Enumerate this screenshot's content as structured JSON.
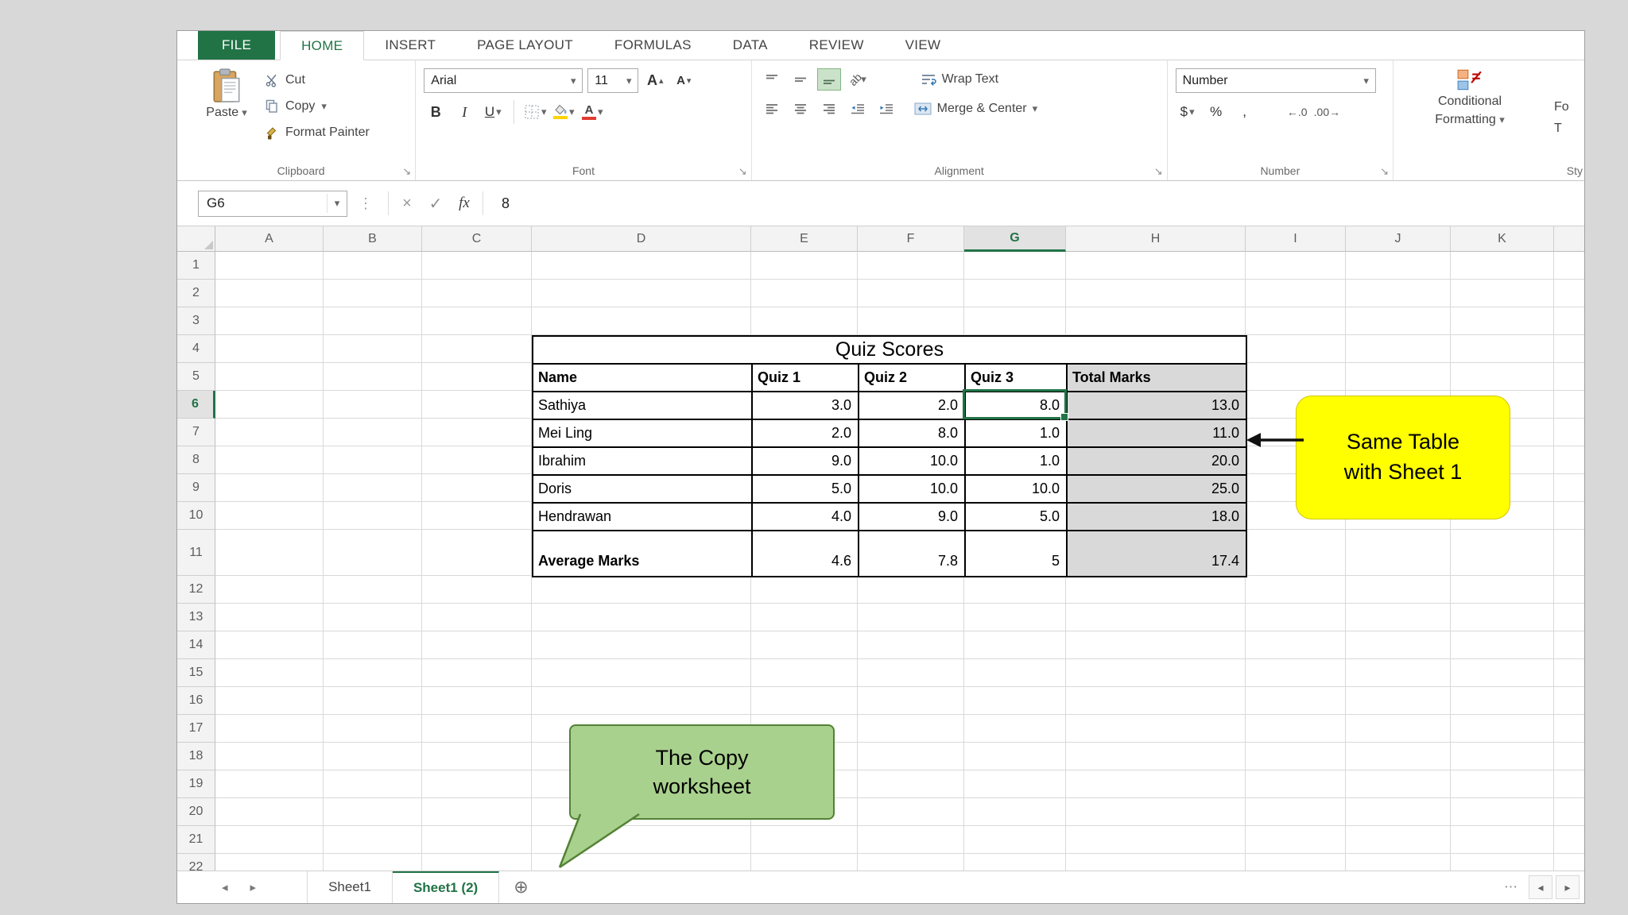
{
  "icons": {
    "chevron_down": "▾",
    "chevron_up": "▴",
    "check": "✓",
    "close": "×",
    "dots_vertical": "⋮",
    "nav_left": "◂",
    "nav_right": "▸",
    "add_sheet": "⊕",
    "ellipsis": "⋯",
    "launcher": "↘"
  },
  "ribbon": {
    "tabs": [
      {
        "label": "FILE"
      },
      {
        "label": "HOME"
      },
      {
        "label": "INSERT"
      },
      {
        "label": "PAGE LAYOUT"
      },
      {
        "label": "FORMULAS"
      },
      {
        "label": "DATA"
      },
      {
        "label": "REVIEW"
      },
      {
        "label": "VIEW"
      }
    ],
    "clipboard": {
      "paste": "Paste",
      "cut": "Cut",
      "copy": "Copy",
      "format_painter": "Format Painter",
      "group": "Clipboard"
    },
    "font": {
      "name_value": "Arial",
      "size_value": "11",
      "bold": "B",
      "italic": "I",
      "underline": "U",
      "letter_a": "A",
      "group": "Font"
    },
    "alignment": {
      "orientation": "ab",
      "wrap_text": "Wrap Text",
      "merge_center": "Merge & Center",
      "group": "Alignment"
    },
    "number": {
      "format_value": "Number",
      "currency": "$",
      "percent": "%",
      "comma": ",",
      "inc_decimal": "←.0",
      "dec_decimal": ".00→",
      "group": "Number"
    },
    "styles": {
      "cf_line1": "Conditional",
      "cf_line2": "Formatting",
      "partial_line1": "Fo",
      "partial_line2": "T",
      "group": "Sty"
    }
  },
  "formula": {
    "name_box": "G6",
    "fx": "fx",
    "value": "8"
  },
  "grid": {
    "columns": [
      "A",
      "B",
      "C",
      "D",
      "E",
      "F",
      "G",
      "H",
      "I",
      "J",
      "K"
    ],
    "row_count": 22,
    "selected_column": "G",
    "selected_row": 6,
    "selected_cell": "G6"
  },
  "table": {
    "title": "Quiz Scores",
    "columns": [
      "Name",
      "Quiz 1",
      "Quiz 2",
      "Quiz 3",
      "Total Marks"
    ],
    "rows": [
      [
        "Sathiya",
        "3.0",
        "2.0",
        "8.0",
        "13.0"
      ],
      [
        "Mei Ling",
        "2.0",
        "8.0",
        "1.0",
        "11.0"
      ],
      [
        "Ibrahim",
        "9.0",
        "10.0",
        "1.0",
        "20.0"
      ],
      [
        "Doris",
        "5.0",
        "10.0",
        "10.0",
        "25.0"
      ],
      [
        "Hendrawan",
        "4.0",
        "9.0",
        "5.0",
        "18.0"
      ]
    ],
    "average_label": "Average Marks",
    "average_values": [
      "4.6",
      "7.8",
      "5",
      "17.4"
    ]
  },
  "callouts": {
    "same_table": {
      "line1": "Same Table",
      "line2": "with Sheet 1"
    },
    "copy_sheet": {
      "line1": "The Copy",
      "line2": "worksheet"
    }
  },
  "sheet_bar": {
    "tabs": [
      {
        "label": "Sheet1"
      },
      {
        "label": "Sheet1 (2)"
      }
    ]
  }
}
